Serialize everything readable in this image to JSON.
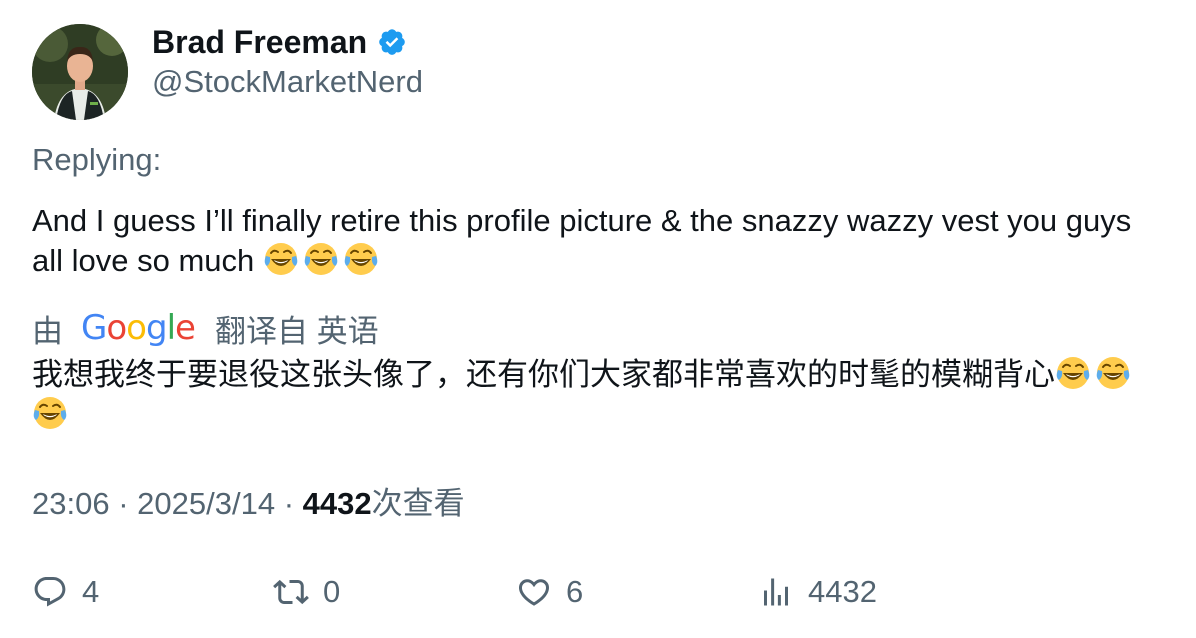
{
  "user": {
    "display_name": "Brad Freeman",
    "handle": "@StockMarketNerd",
    "verified": true,
    "verified_color": "#1d9bf0",
    "avatar_icon": "profile-photo"
  },
  "replying_label": "Replying:",
  "tweet": {
    "text": "And I guess I’ll finally retire this profile picture & the snazzy wazzy vest you guys all love so much",
    "trailing_emoji": [
      "face-with-tears-of-joy",
      "face-with-tears-of-joy",
      "face-with-tears-of-joy"
    ]
  },
  "translation": {
    "prefix": "由",
    "provider": "Google",
    "suffix": "翻译自 英语",
    "text": "我想我终于要退役这张头像了，还有你们大家都非常喜欢的时髦的模糊背心",
    "trailing_emoji": [
      "face-with-tears-of-joy",
      "face-with-tears-of-joy",
      "face-with-tears-of-joy"
    ]
  },
  "meta": {
    "time": "23:06",
    "separator": "·",
    "date": "2025/3/14",
    "views_count": "4432",
    "views_label": "次查看"
  },
  "actions": {
    "reply": {
      "icon": "reply-icon",
      "count": "4"
    },
    "retweet": {
      "icon": "retweet-icon",
      "count": "0"
    },
    "like": {
      "icon": "heart-icon",
      "count": "6"
    },
    "views": {
      "icon": "views-icon",
      "count": "4432"
    }
  },
  "colors": {
    "text_primary": "#0f1419",
    "text_secondary": "#536471",
    "accent": "#1d9bf0"
  }
}
